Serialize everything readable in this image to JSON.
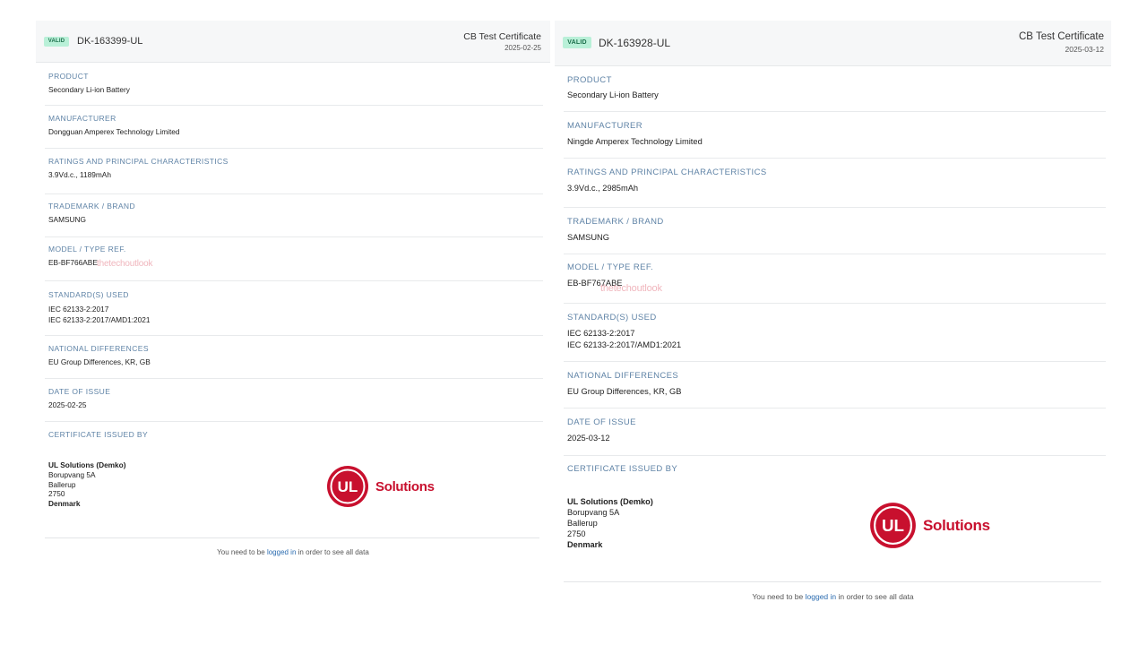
{
  "certificates": [
    {
      "status_badge": "VALID",
      "cert_id": "DK-163399-UL",
      "cert_type": "CB Test Certificate",
      "cert_date": "2025-02-25",
      "product_label": "PRODUCT",
      "product_value": "Secondary Li-ion Battery",
      "manufacturer_label": "MANUFACTURER",
      "manufacturer_value": "Dongguan Amperex Technology Limited",
      "ratings_label": "RATINGS AND PRINCIPAL CHARACTERISTICS",
      "ratings_value": "3.9Vd.c., 1189mAh",
      "trademark_label": "TRADEMARK / BRAND",
      "trademark_value": "SAMSUNG",
      "model_label": "MODEL / TYPE REF.",
      "model_value": "EB-BF766ABE",
      "watermark": "thetechoutlook",
      "standards_label": "STANDARD(S) USED",
      "standards_line1": "IEC 62133-2:2017",
      "standards_line2": "IEC 62133-2:2017/AMD1:2021",
      "national_label": "NATIONAL DIFFERENCES",
      "national_value": "EU Group Differences,  KR,  GB",
      "date_label": "DATE OF ISSUE",
      "date_value": "2025-02-25",
      "issued_by_label": "CERTIFICATE ISSUED BY",
      "issuer_name": "UL Solutions (Demko)",
      "issuer_street": "Borupvang 5A",
      "issuer_city": "Ballerup",
      "issuer_zip": "2750",
      "issuer_country": "Denmark",
      "logo_text": "Solutions",
      "logo_mark": "UL",
      "footer_before": "You need to be ",
      "footer_link": "logged in",
      "footer_after": " in order to see all data"
    },
    {
      "status_badge": "VALID",
      "cert_id": "DK-163928-UL",
      "cert_type": "CB Test Certificate",
      "cert_date": "2025-03-12",
      "product_label": "PRODUCT",
      "product_value": "Secondary Li-ion Battery",
      "manufacturer_label": "MANUFACTURER",
      "manufacturer_value": "Ningde Amperex Technology Limited",
      "ratings_label": "RATINGS AND PRINCIPAL CHARACTERISTICS",
      "ratings_value": "3.9Vd.c., 2985mAh",
      "trademark_label": "TRADEMARK / BRAND",
      "trademark_value": "SAMSUNG",
      "model_label": "MODEL / TYPE REF.",
      "model_value": "EB-BF767ABE",
      "watermark": "thetechoutlook",
      "standards_label": "STANDARD(S) USED",
      "standards_line1": "IEC 62133-2:2017",
      "standards_line2": "IEC 62133-2:2017/AMD1:2021",
      "national_label": "NATIONAL DIFFERENCES",
      "national_value": "EU Group Differences,  KR,  GB",
      "date_label": "DATE OF ISSUE",
      "date_value": "2025-03-12",
      "issued_by_label": "CERTIFICATE ISSUED BY",
      "issuer_name": "UL Solutions (Demko)",
      "issuer_street": "Borupvang 5A",
      "issuer_city": "Ballerup",
      "issuer_zip": "2750",
      "issuer_country": "Denmark",
      "logo_text": "Solutions",
      "logo_mark": "UL",
      "footer_before": "You need to be ",
      "footer_link": "logged in",
      "footer_after": " in order to see all data"
    }
  ],
  "colors": {
    "label": "#5f83a6",
    "badge_bg": "#b9f0d8",
    "brand_red": "#c8102e",
    "link": "#2b6cb0",
    "watermark": "#f0b6bd"
  }
}
